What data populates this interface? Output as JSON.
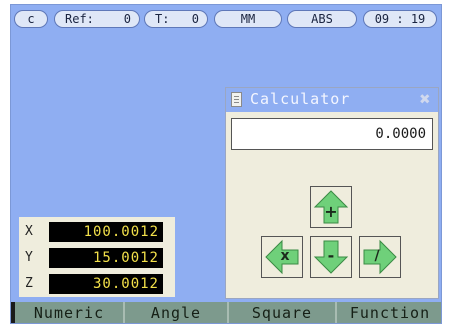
{
  "status": {
    "mode_letter": "c",
    "ref_label": "Ref:",
    "ref_value": "0",
    "tool_label": "T:",
    "tool_value": "0",
    "units": "MM",
    "coord_mode": "ABS",
    "time": "09 : 19"
  },
  "calculator": {
    "title": "Calculator",
    "display": "0.0000",
    "keys": {
      "add": "+",
      "multiply": "x",
      "subtract": "-",
      "divide": "/"
    }
  },
  "axes": [
    {
      "name": "X",
      "value": "100.0012"
    },
    {
      "name": "Y",
      "value": "15.0012"
    },
    {
      "name": "Z",
      "value": "30.0012"
    }
  ],
  "softkeys": [
    "Numeric",
    "Angle",
    "Square",
    "Function"
  ],
  "colors": {
    "screen_bg": "#8faef2",
    "panel_bg": "#efeddd",
    "key_green": "#6fd07a",
    "readout_text": "#f2e04a",
    "softkey_bg": "#7d9a8d"
  }
}
